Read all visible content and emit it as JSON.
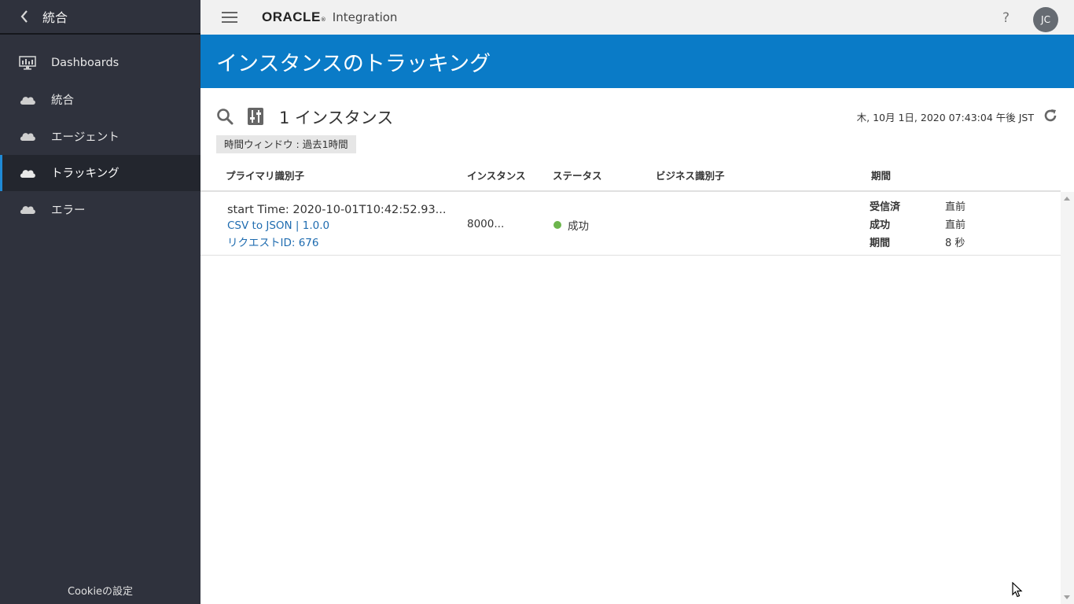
{
  "sidebar": {
    "title": "統合",
    "items": [
      {
        "label": "Dashboards",
        "icon": "monitor-icon"
      },
      {
        "label": "統合",
        "icon": "cloud-icon"
      },
      {
        "label": "エージェント",
        "icon": "cloud-icon"
      },
      {
        "label": "トラッキング",
        "icon": "cloud-icon",
        "active": true
      },
      {
        "label": "エラー",
        "icon": "cloud-icon"
      }
    ],
    "cookie_label": "Cookieの設定"
  },
  "topbar": {
    "brand": "ORACLE",
    "brand_mark": "®",
    "product": "Integration",
    "help": "?",
    "avatar": "JC"
  },
  "page": {
    "title": "インスタンスのトラッキング"
  },
  "toolbar": {
    "count": "1 インスタンス",
    "timestamp": "木, 10月 1日, 2020 07:43:04 午後 JST",
    "time_window": "時間ウィンドウ : 過去1時間"
  },
  "table": {
    "headers": {
      "primary": "プライマリ識別子",
      "instance": "インスタンス",
      "status": "ステータス",
      "business": "ビジネス識別子",
      "duration": "期間"
    },
    "rows": [
      {
        "primary": "start Time: 2020-10-01T10:42:52.93...",
        "integration": "CSV to JSON | 1.0.0",
        "request": "リクエストID: 676",
        "instance": "8000...",
        "status": "成功",
        "status_color": "#6cb54c",
        "business": "",
        "duration": [
          {
            "key": "受信済",
            "value": "直前"
          },
          {
            "key": "成功",
            "value": "直前"
          },
          {
            "key": "期間",
            "value": "8 秒"
          }
        ]
      }
    ]
  },
  "colors": {
    "accent": "#0a7bc7",
    "sidebar": "#2f323d",
    "link": "#1f6cb0",
    "success": "#6cb54c"
  }
}
